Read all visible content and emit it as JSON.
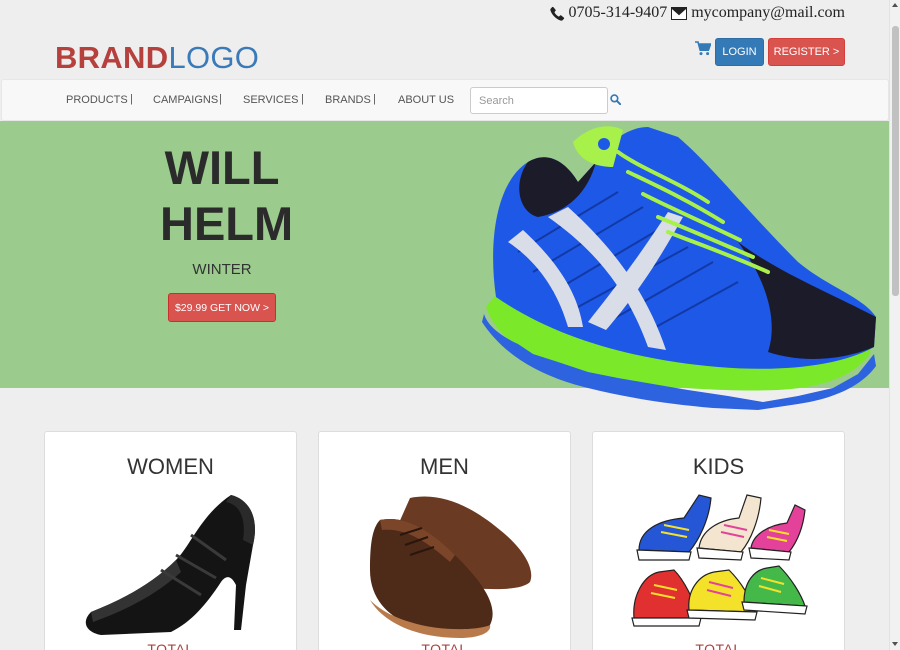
{
  "contact": {
    "phone": "0705-314-9407",
    "email": "mycompany@mail.com"
  },
  "logo": {
    "brand": "BRAND",
    "text": "LOGO"
  },
  "header": {
    "login_label": "LOGIN",
    "register_label": "REGISTER >"
  },
  "nav": {
    "items": [
      "PRODUCTS",
      "CAMPAIGNS",
      "SERVICES",
      "BRANDS",
      "ABOUT US"
    ],
    "separator": "|",
    "search_placeholder": "Search"
  },
  "hero": {
    "title_line1": "WILL",
    "title_line2": "HELM",
    "subtitle": "WINTER",
    "cta_label": "$29.99 GET NOW >"
  },
  "cards": [
    {
      "title": "WOMEN",
      "total_label": "TOTAL"
    },
    {
      "title": "MEN",
      "total_label": "TOTAL"
    },
    {
      "title": "KIDS",
      "total_label": "TOTAL"
    }
  ],
  "colors": {
    "brand_red": "#b5403c",
    "brand_blue": "#3a7ab8",
    "hero_green": "#9bcb8d",
    "cta_red": "#d9534f",
    "primary_blue": "#337ab7"
  }
}
